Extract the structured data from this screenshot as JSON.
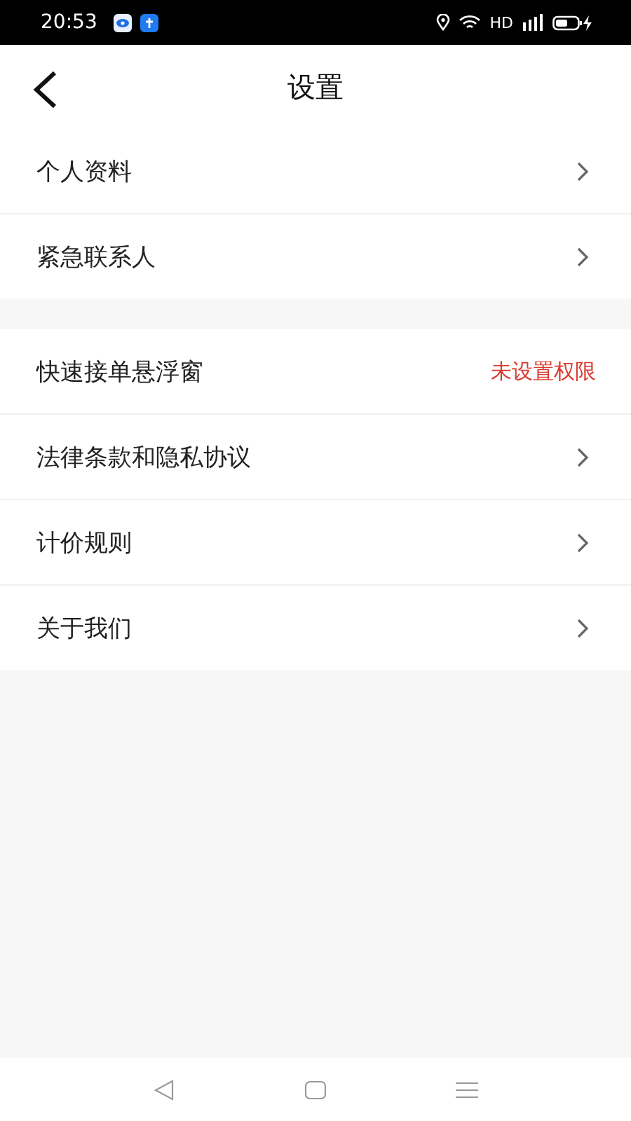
{
  "status_bar": {
    "time": "20:53",
    "network": "HD"
  },
  "header": {
    "title": "设置"
  },
  "groups": [
    {
      "items": [
        {
          "label": "个人资料",
          "kind": "link"
        },
        {
          "label": "紧急联系人",
          "kind": "link"
        }
      ]
    },
    {
      "items": [
        {
          "label": "快速接单悬浮窗",
          "kind": "status",
          "value": "未设置权限"
        },
        {
          "label": "法律条款和隐私协议",
          "kind": "link"
        },
        {
          "label": "计价规则",
          "kind": "link"
        },
        {
          "label": "关于我们",
          "kind": "link"
        }
      ]
    }
  ]
}
